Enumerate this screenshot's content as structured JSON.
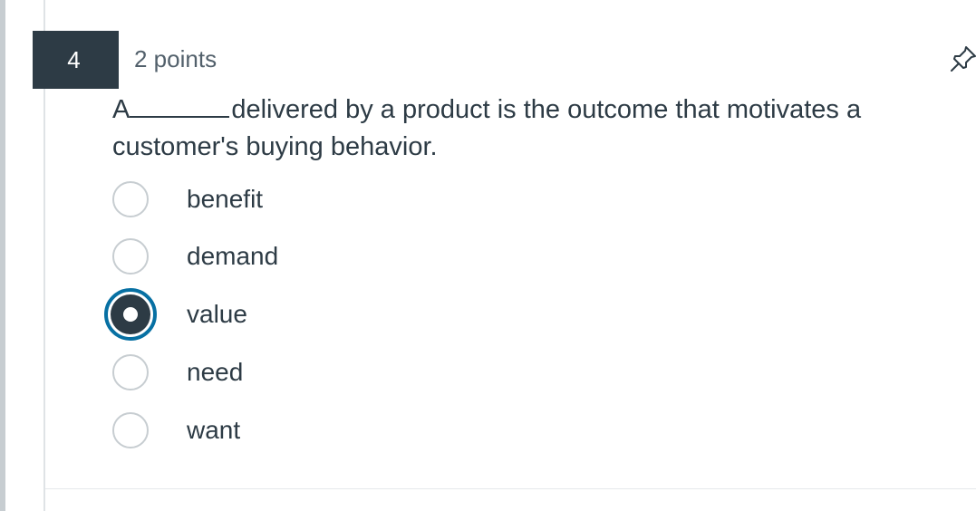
{
  "question": {
    "number": "4",
    "points": "2 points",
    "text_before": "A",
    "text_after": "delivered by a product is the outcome that motivates a customer's buying behavior."
  },
  "options": [
    {
      "label": "benefit",
      "selected": false
    },
    {
      "label": "demand",
      "selected": false
    },
    {
      "label": "value",
      "selected": true
    },
    {
      "label": "need",
      "selected": false
    },
    {
      "label": "want",
      "selected": false
    }
  ],
  "colors": {
    "number_badge_bg": "#2d3b45",
    "text": "#2d3b45",
    "selected_ring": "#0770a3",
    "radio_border": "#c7cdd1"
  },
  "icons": {
    "pin": "pin-icon"
  }
}
